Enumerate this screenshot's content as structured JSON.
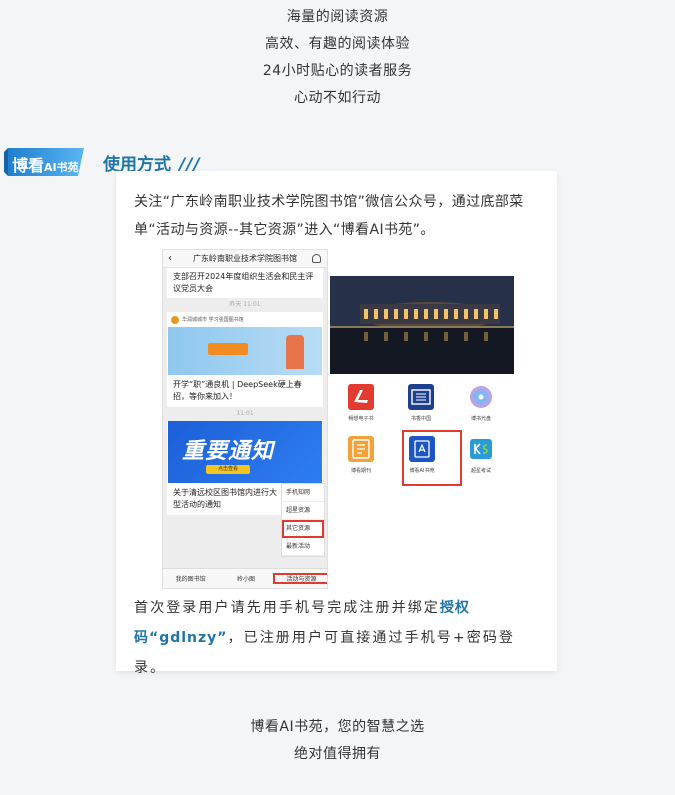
{
  "intro_lines": [
    "海量的阅读资源",
    "高效、有趣的阅读体验",
    "24小时贴心的读者服务",
    "心动不如行动"
  ],
  "badge": {
    "main": "博看",
    "sub": "AI书苑"
  },
  "section": {
    "title": "使用方式",
    "decor": "///"
  },
  "card": {
    "intro_text": "关注“广东岭南职业技术学院图书馆”微信公众号，通过底部菜单“活动与资源--其它资源”进入“博看AI书苑”。",
    "outro_prefix": "首次登录用户请先用手机号完成注册并绑定",
    "outro_highlight": "授权码“gdlnzy”",
    "outro_suffix": "，已注册用户可直接通过手机号+密码登录。"
  },
  "phone": {
    "title": "广东岭南职业技术学院图书馆",
    "msg1": "支部召开2024年度组织生活会和民主评议党员大会",
    "time1": "昨天 11:01",
    "article1_head": "华润城城市 学习强国图书馆",
    "article1_title": "开学“职”通良机 | DeepSeek硬上春招，等你来加入！",
    "time2": "11:01",
    "banner2_text": "重要通知",
    "banner2_btn": "点击查看",
    "article2_title": "关于清远校区图书馆内进行大型活动的通知",
    "menu": [
      "手机知网",
      "超星资源",
      "其它资源",
      "最新活动"
    ],
    "bottom": [
      "我的图书馆",
      "岭小图",
      "活动与资源"
    ]
  },
  "grid_items": [
    "畅想电子书",
    "书香中国",
    "博书光盘",
    "博看期刊",
    "博看AI书苑",
    "超星考试"
  ],
  "closing_lines": [
    "博看AI书苑，您的智慧之选",
    "绝对值得拥有"
  ],
  "colors": {
    "accent": "#1f74a8",
    "badge": "#2b8bd0",
    "highlight_box": "#e23a2f"
  }
}
